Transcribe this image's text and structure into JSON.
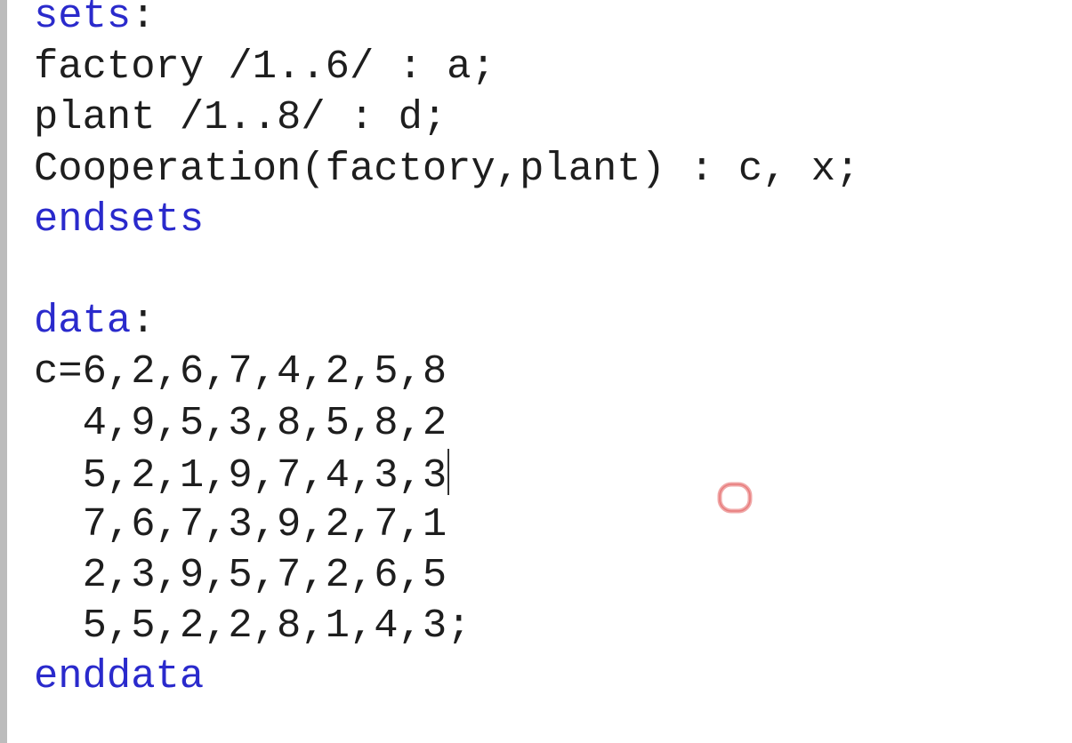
{
  "editor": {
    "lines": [
      {
        "kw": "sets",
        "text": ":"
      },
      {
        "text": "factory /1..6/ : a;"
      },
      {
        "text": "plant /1..8/ : d;"
      },
      {
        "text": "Cooperation(factory,plant) : c, x;"
      },
      {
        "kw": "endsets",
        "text": ""
      },
      {
        "text": ""
      },
      {
        "kw": "data",
        "text": ":"
      },
      {
        "text": "c=6,2,6,7,4,2,5,8"
      },
      {
        "text": "  4,9,5,3,8,5,8,2"
      },
      {
        "text": "  5,2,1,9,7,4,3,3",
        "caret": true
      },
      {
        "text": "  7,6,7,3,9,2,7,1"
      },
      {
        "text": "  2,3,9,5,7,2,6,5"
      },
      {
        "text": "  5,5,2,2,8,1,4,3;"
      },
      {
        "kw": "enddata",
        "text": ""
      }
    ],
    "colors": {
      "keyword": "#2a2acc",
      "text": "#1e1e1e",
      "background": "#ffffff",
      "gutter": "#bcbcbc",
      "cursor": "#e05050"
    },
    "icons": {
      "cursor": "mouse-cursor-ring-icon"
    }
  }
}
